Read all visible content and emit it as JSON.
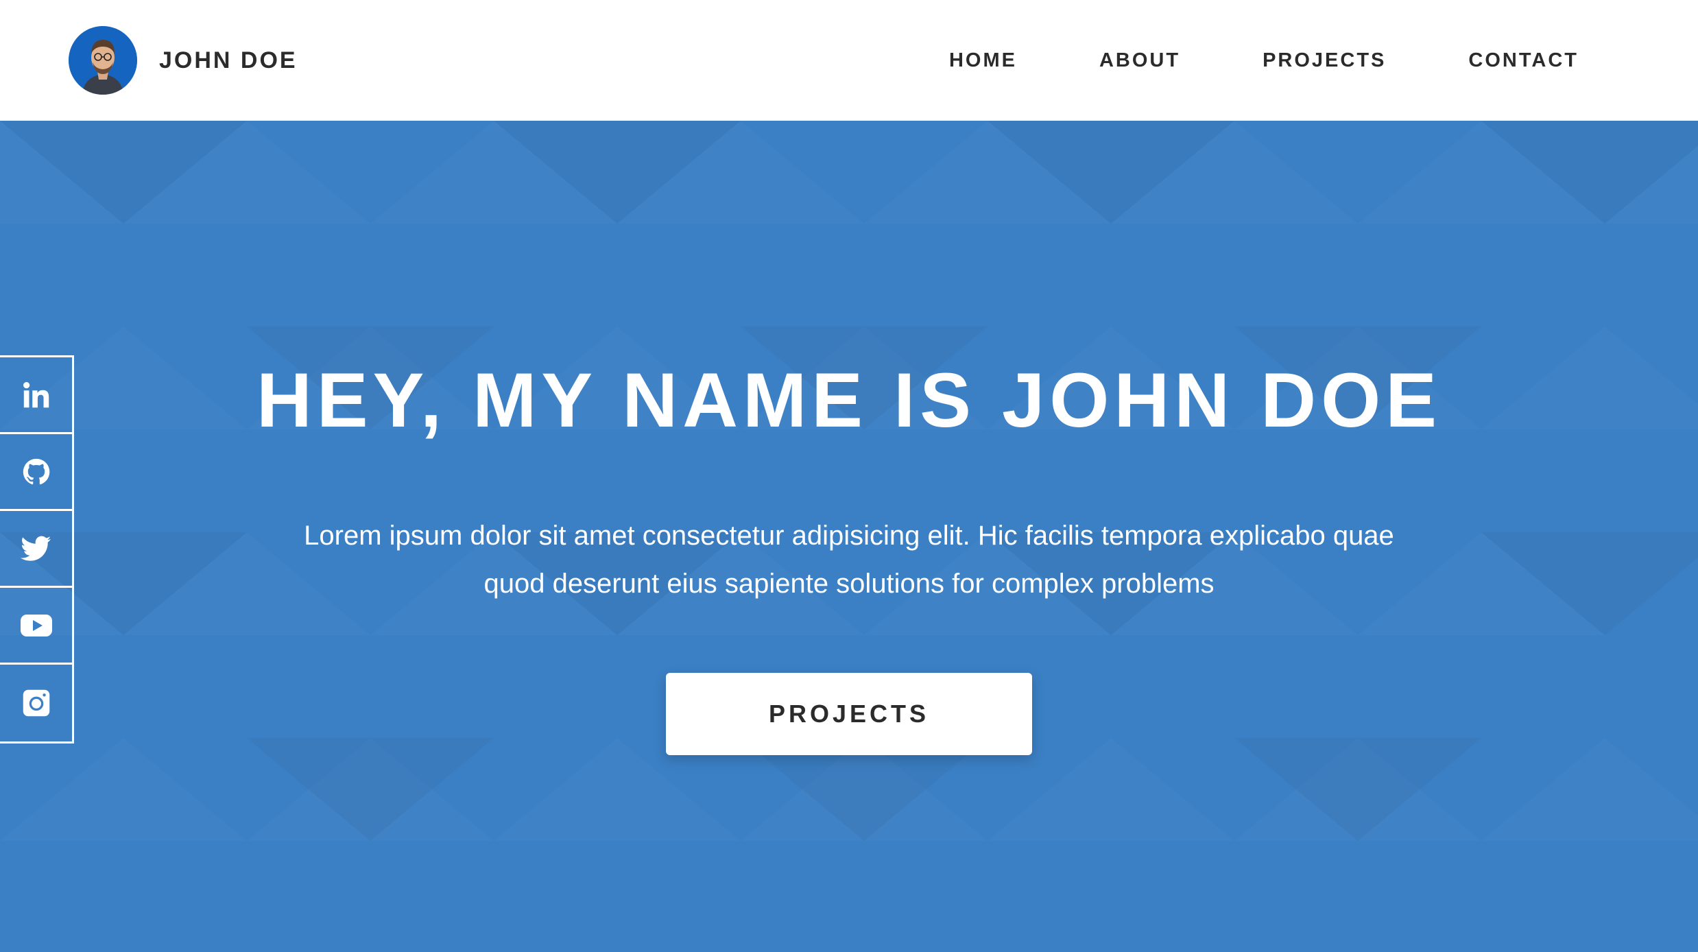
{
  "header": {
    "brand_name": "JOHN DOE",
    "avatar_bg": "#1565c0",
    "nav": [
      {
        "label": "HOME"
      },
      {
        "label": "ABOUT"
      },
      {
        "label": "PROJECTS"
      },
      {
        "label": "CONTACT"
      }
    ]
  },
  "hero": {
    "title": "HEY, MY NAME IS JOHN DOE",
    "text": "Lorem ipsum dolor sit amet consectetur adipisicing elit. Hic facilis tempora explicabo quae quod deserunt eius sapiente solutions for complex problems",
    "button_label": "PROJECTS",
    "bg_color": "#3b7fc4"
  },
  "social": [
    {
      "icon": "linkedin-icon"
    },
    {
      "icon": "github-icon"
    },
    {
      "icon": "twitter-icon"
    },
    {
      "icon": "youtube-icon"
    },
    {
      "icon": "instagram-icon"
    }
  ]
}
